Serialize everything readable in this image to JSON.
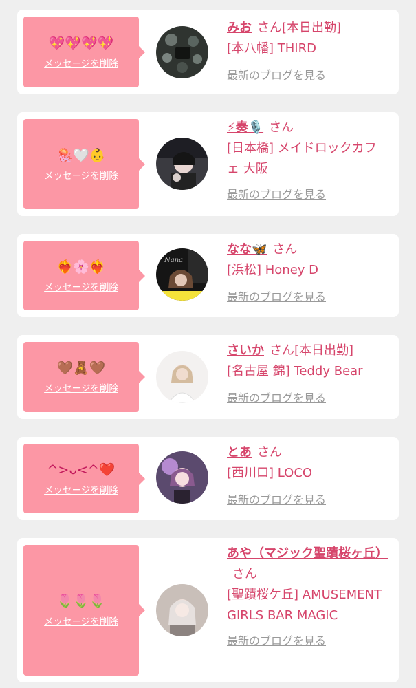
{
  "cards": [
    {
      "emoji": "💖💖💖💖",
      "delete_label": "メッセージを削除",
      "name": "みお",
      "san": "さん",
      "status": "[本日出勤]",
      "shop": "[本八幡] THIRD",
      "blog_label": "最新のブログを見る",
      "avatar": "avatar-photo"
    },
    {
      "emoji": "🪼🤍👶",
      "delete_label": "メッセージを削除",
      "name": "⚡奏🎙️",
      "san": "さん",
      "status": "",
      "shop": "[日本橋] メイドロックカフェ 大阪",
      "blog_label": "最新のブログを見る",
      "avatar": "avatar-photo"
    },
    {
      "emoji": "❤️‍🔥🌸❤️‍🔥",
      "delete_label": "メッセージを削除",
      "name": "なな🦋",
      "san": "さん",
      "status": "",
      "shop": "[浜松] Honey D",
      "blog_label": "最新のブログを見る",
      "avatar": "avatar-photo"
    },
    {
      "emoji": "🤎🧸🤎",
      "delete_label": "メッセージを削除",
      "name": "さいか",
      "san": "さん",
      "status": "[本日出勤]",
      "shop": "[名古屋 錦] Teddy Bear",
      "blog_label": "最新のブログを見る",
      "avatar": "avatar-photo"
    },
    {
      "emoji": "^>ᴗ<^❤️",
      "delete_label": "メッセージを削除",
      "name": "とあ",
      "san": "さん",
      "status": "",
      "shop": "[西川口] LOCO",
      "blog_label": "最新のブログを見る",
      "avatar": "avatar-photo"
    },
    {
      "emoji": "🌷🌷🌷",
      "delete_label": "メッセージを削除",
      "name": "あや（マジック聖蹟桜ヶ丘）",
      "san": "さん",
      "status": "",
      "shop": "[聖蹟桜ケ丘] AMUSEMENT GIRLS BAR MAGIC",
      "blog_label": "最新のブログを見る",
      "avatar": "avatar-photo"
    }
  ],
  "colors": {
    "accent": "#d6456b",
    "bubble": "#fc97a5",
    "link_gray": "#9a9a9a",
    "background": "#efefef"
  }
}
